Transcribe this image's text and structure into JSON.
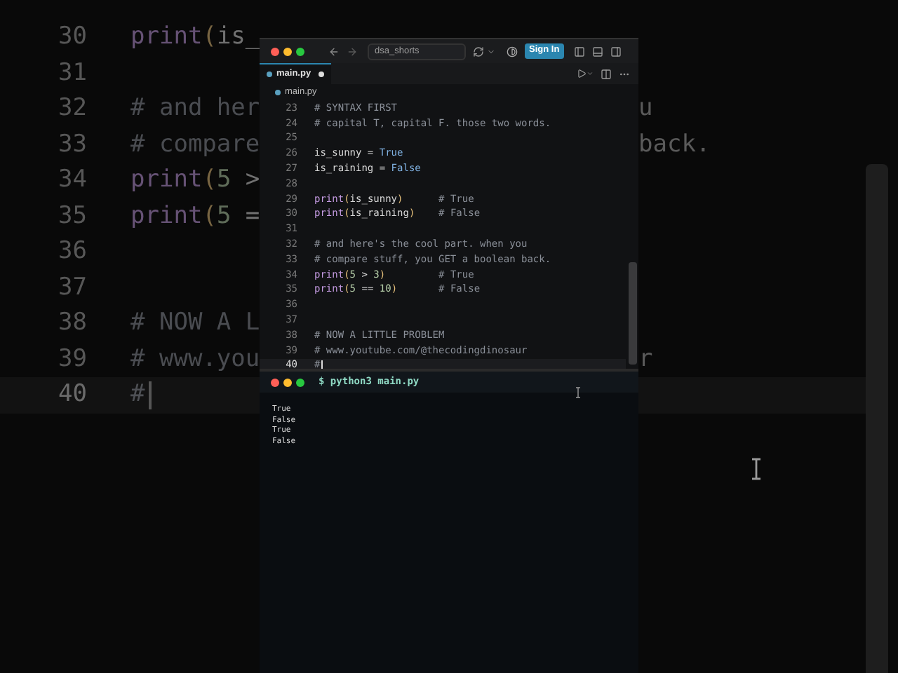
{
  "background_code": {
    "lines": [
      {
        "number": "30",
        "current": false,
        "tokens": [
          {
            "kind": "builtin",
            "text": "print"
          },
          {
            "kind": "paren",
            "text": "("
          },
          {
            "kind": "ident",
            "text": "is_"
          }
        ]
      },
      {
        "number": "31",
        "current": false
      },
      {
        "number": "32",
        "current": false,
        "tokens": [
          {
            "kind": "comment",
            "text": "# and her"
          }
        ],
        "tail": "u"
      },
      {
        "number": "33",
        "current": false,
        "tokens": [
          {
            "kind": "comment",
            "text": "# compare"
          }
        ],
        "tail": "back."
      },
      {
        "number": "34",
        "current": false,
        "tokens": [
          {
            "kind": "builtin",
            "text": "print"
          },
          {
            "kind": "paren",
            "text": "("
          },
          {
            "kind": "num",
            "text": "5"
          },
          {
            "kind": "op",
            "text": " >"
          }
        ]
      },
      {
        "number": "35",
        "current": false,
        "tokens": [
          {
            "kind": "builtin",
            "text": "print"
          },
          {
            "kind": "paren",
            "text": "("
          },
          {
            "kind": "num",
            "text": "5"
          },
          {
            "kind": "op",
            "text": " ="
          }
        ]
      },
      {
        "number": "36",
        "current": false
      },
      {
        "number": "37",
        "current": false
      },
      {
        "number": "38",
        "current": false,
        "tokens": [
          {
            "kind": "comment",
            "text": "# NOW A L"
          }
        ]
      },
      {
        "number": "39",
        "current": false,
        "tokens": [
          {
            "kind": "comment",
            "text": "# www.you"
          }
        ],
        "tail": "r"
      },
      {
        "number": "40",
        "current": true,
        "tokens": [
          {
            "kind": "comment",
            "text": "#"
          }
        ]
      }
    ]
  },
  "editor": {
    "title_bar": {
      "search": "dsa_shorts",
      "sign_in": "Sign In"
    },
    "tab": {
      "label": "main.py",
      "modified": true
    },
    "breadcrumb": "main.py",
    "lines": [
      {
        "number": "23",
        "current": false,
        "tokens": [
          {
            "kind": "comment",
            "text": "# SYNTAX FIRST"
          }
        ]
      },
      {
        "number": "24",
        "current": false,
        "tokens": [
          {
            "kind": "comment",
            "text": "# capital T, capital F. those two words."
          }
        ]
      },
      {
        "number": "25",
        "current": false
      },
      {
        "number": "26",
        "current": false,
        "tokens": [
          {
            "kind": "ident",
            "text": "is_sunny = "
          },
          {
            "kind": "const",
            "text": "True"
          }
        ]
      },
      {
        "number": "27",
        "current": false,
        "tokens": [
          {
            "kind": "ident",
            "text": "is_raining = "
          },
          {
            "kind": "const",
            "text": "False"
          }
        ]
      },
      {
        "number": "28",
        "current": false
      },
      {
        "number": "29",
        "current": false,
        "tokens": [
          {
            "kind": "builtin",
            "text": "print"
          },
          {
            "kind": "paren",
            "text": "("
          },
          {
            "kind": "ident",
            "text": "is_sunny"
          },
          {
            "kind": "paren",
            "text": ")"
          },
          {
            "kind": "comment",
            "text": "      # True"
          }
        ]
      },
      {
        "number": "30",
        "current": false,
        "tokens": [
          {
            "kind": "builtin",
            "text": "print"
          },
          {
            "kind": "paren",
            "text": "("
          },
          {
            "kind": "ident",
            "text": "is_raining"
          },
          {
            "kind": "paren",
            "text": ")"
          },
          {
            "kind": "comment",
            "text": "    # False"
          }
        ]
      },
      {
        "number": "31",
        "current": false
      },
      {
        "number": "32",
        "current": false,
        "tokens": [
          {
            "kind": "comment",
            "text": "# and here's the cool part. when you"
          }
        ]
      },
      {
        "number": "33",
        "current": false,
        "tokens": [
          {
            "kind": "comment",
            "text": "# compare stuff, you GET a boolean back."
          }
        ]
      },
      {
        "number": "34",
        "current": false,
        "tokens": [
          {
            "kind": "builtin",
            "text": "print"
          },
          {
            "kind": "paren",
            "text": "("
          },
          {
            "kind": "num",
            "text": "5"
          },
          {
            "kind": "op",
            "text": " > "
          },
          {
            "kind": "num",
            "text": "3"
          },
          {
            "kind": "paren",
            "text": ")"
          },
          {
            "kind": "comment",
            "text": "         # True"
          }
        ]
      },
      {
        "number": "35",
        "current": false,
        "tokens": [
          {
            "kind": "builtin",
            "text": "print"
          },
          {
            "kind": "paren",
            "text": "("
          },
          {
            "kind": "num",
            "text": "5"
          },
          {
            "kind": "op",
            "text": " == "
          },
          {
            "kind": "num",
            "text": "10"
          },
          {
            "kind": "paren",
            "text": ")"
          },
          {
            "kind": "comment",
            "text": "       # False"
          }
        ]
      },
      {
        "number": "36",
        "current": false
      },
      {
        "number": "37",
        "current": false
      },
      {
        "number": "38",
        "current": false,
        "tokens": [
          {
            "kind": "comment",
            "text": "# NOW A LITTLE PROBLEM"
          }
        ]
      },
      {
        "number": "39",
        "current": false,
        "tokens": [
          {
            "kind": "comment",
            "text": "# www.youtube.com/@thecodingdinosaur"
          }
        ]
      },
      {
        "number": "40",
        "current": true,
        "tokens": [
          {
            "kind": "comment",
            "text": "#"
          }
        ]
      }
    ]
  },
  "terminal": {
    "command": "$ python3 main.py",
    "output": [
      "True",
      "False",
      "True",
      "False"
    ]
  }
}
